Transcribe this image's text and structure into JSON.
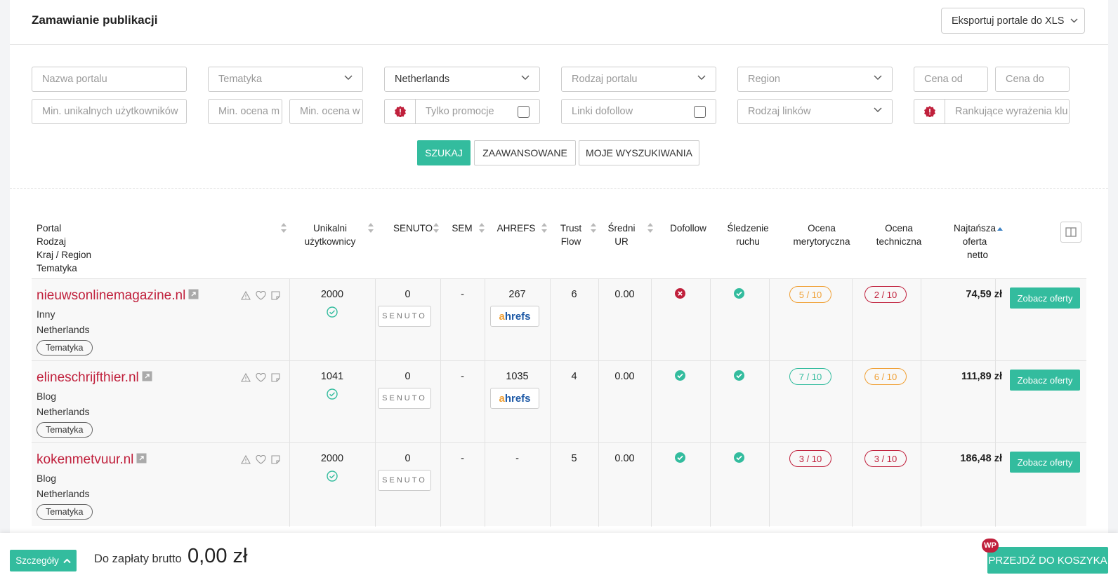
{
  "header": {
    "title": "Zamawianie publikacji",
    "export_label": "Eksportuj portale do XLS"
  },
  "filters": {
    "portal_name_ph": "Nazwa portalu",
    "topic_ph": "Tematyka",
    "country_value": "Netherlands",
    "portal_type_ph": "Rodzaj portalu",
    "region_ph": "Region",
    "price_from_ph": "Cena od",
    "price_to_ph": "Cena do",
    "min_users_ph": "Min. unikalnych użytkowników",
    "min_content_score_ph": "Min. ocena m",
    "min_tech_score_ph": "Min. ocena w",
    "promo_only_label": "Tylko promocje",
    "dofollow_label": "Linki dofollow",
    "link_type_ph": "Rodzaj linków",
    "keywords_ph": "Rankujące wyrażenia klu"
  },
  "actions": {
    "search": "SZUKAJ",
    "advanced": "ZAAWANSOWANE",
    "my_searches": "MOJE WYSZUKIWANIA"
  },
  "table": {
    "headers": {
      "portal_l1": "Portal",
      "portal_l2": "Rodzaj",
      "portal_l3": "Kraj / Region",
      "portal_l4": "Tematyka",
      "users_l1": "Unikalni",
      "users_l2": "użytkownicy",
      "senuto": "SENUTO",
      "sem": "SEM",
      "ahrefs": "AHREFS",
      "trust_l1": "Trust",
      "trust_l2": "Flow",
      "ur_l1": "Średni",
      "ur_l2": "UR",
      "dofollow": "Dofollow",
      "tracking_l1": "Śledzenie",
      "tracking_l2": "ruchu",
      "content_l1": "Ocena",
      "content_l2": "merytoryczna",
      "tech_l1": "Ocena",
      "tech_l2": "techniczna",
      "offer_l1": "Najtańsza",
      "offer_l2": "oferta",
      "offer_l3": "netto"
    },
    "senuto_logo": "SENUTO",
    "ahrefs_logo_a": "a",
    "ahrefs_logo_rest": "hrefs",
    "offer_button": "Zobacz oferty",
    "rows": [
      {
        "name": "nieuwsonlinemagazine.nl",
        "type": "Inny",
        "country": "Netherlands",
        "tag": "Tematyka",
        "users": "2000",
        "senuto": "0",
        "sem": "-",
        "ahrefs": "267",
        "trust_flow": "6",
        "ur": "0.00",
        "dofollow": "no",
        "tracking": "yes",
        "content_score": "5 / 10",
        "content_color": "orange",
        "tech_score": "2 / 10",
        "tech_color": "red",
        "price": "74,59 zł"
      },
      {
        "name": "elineschrijfthier.nl",
        "type": "Blog",
        "country": "Netherlands",
        "tag": "Tematyka",
        "users": "1041",
        "senuto": "0",
        "sem": "-",
        "ahrefs": "1035",
        "trust_flow": "4",
        "ur": "0.00",
        "dofollow": "yes",
        "tracking": "yes",
        "content_score": "7 / 10",
        "content_color": "teal",
        "tech_score": "6 / 10",
        "tech_color": "orange",
        "price": "111,89 zł"
      },
      {
        "name": "kokenmetvuur.nl",
        "type": "Blog",
        "country": "Netherlands",
        "tag": "Tematyka",
        "users": "2000",
        "senuto": "0",
        "sem": "-",
        "ahrefs": "-",
        "trust_flow": "5",
        "ur": "0.00",
        "dofollow": "yes",
        "tracking": "yes",
        "content_score": "3 / 10",
        "content_color": "red",
        "tech_score": "3 / 10",
        "tech_color": "red",
        "price": "186,48 zł"
      }
    ]
  },
  "footer": {
    "details_label": "Szczegóły",
    "pay_label": "Do zapłaty brutto",
    "pay_amount": "0,00 zł",
    "cart_label": "PRZEJDŹ DO KOSZYKA",
    "wp_badge": "WP"
  },
  "colors": {
    "accent": "#33bc9e",
    "brand_red": "#c0203c",
    "orange": "#f0a035"
  },
  "icons": [
    "chevron-down-icon",
    "alert-badge-icon",
    "external-link-icon",
    "warning-icon",
    "heart-icon",
    "note-icon",
    "check-circle-icon",
    "x-circle-icon",
    "columns-icon",
    "chevron-up-icon"
  ]
}
